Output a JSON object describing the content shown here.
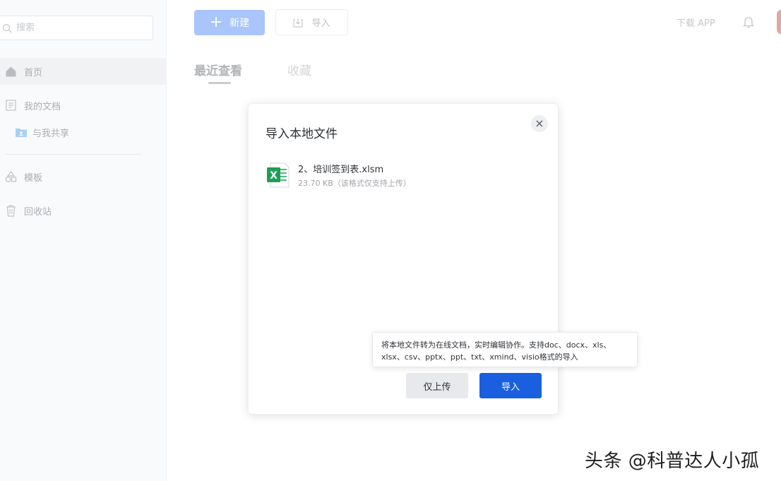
{
  "sidebar": {
    "search_placeholder": "搜索",
    "items": [
      {
        "label": "首页",
        "icon": "home-icon",
        "active": true
      },
      {
        "label": "我的文档",
        "icon": "document-icon"
      },
      {
        "label": "与我共享",
        "icon": "shared-folder-icon"
      },
      {
        "label": "模板",
        "icon": "template-icon"
      },
      {
        "label": "回收站",
        "icon": "trash-icon"
      }
    ]
  },
  "topbar": {
    "new_label": "新建",
    "import_label": "导入",
    "download_app": "下载 APP"
  },
  "tabs": [
    {
      "label": "最近查看",
      "active": true
    },
    {
      "label": "收藏"
    }
  ],
  "modal": {
    "title": "导入本地文件",
    "close_symbol": "×",
    "file": {
      "name": "2、培训签到表.xlsm",
      "meta": "23.70 KB（该格式仅支持上传）",
      "icon_letter": "X"
    },
    "tooltip": "将本地文件转为在线文档，实时编辑协作。支持doc、docx、xls、xlsx、csv、pptx、ppt、txt、xmind、visio格式的导入",
    "upload_only_label": "仅上传",
    "import_label": "导入"
  },
  "watermark": "头条 @科普达人小孤",
  "colors": {
    "primary": "#1a5fe0",
    "primary_disabled": "#a9c5fb",
    "excel_green": "#1e9e56"
  }
}
